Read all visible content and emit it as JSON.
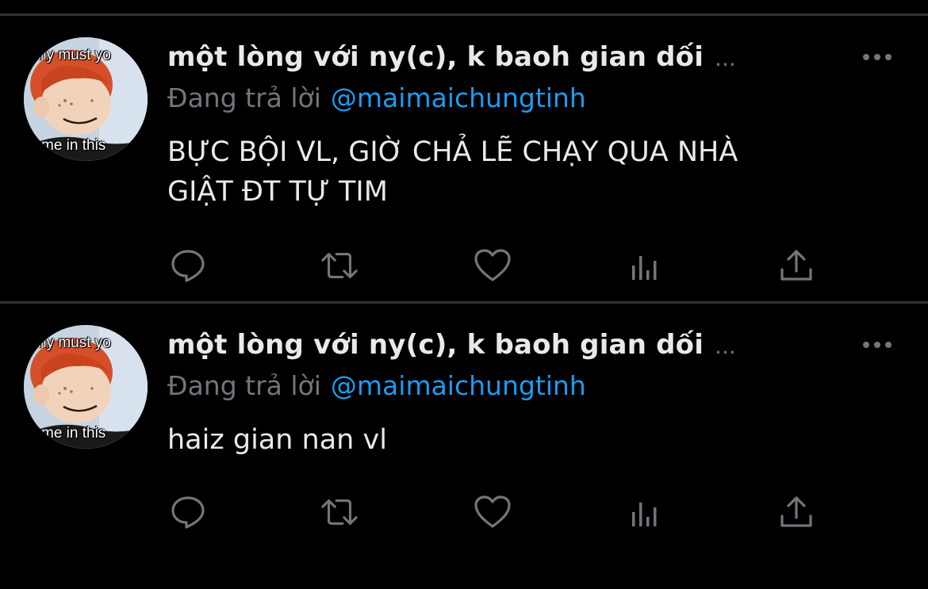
{
  "colors": {
    "background": "#000000",
    "text_primary": "#e7e9ea",
    "text_secondary": "#71767b",
    "accent": "#1d9bf0",
    "divider": "#2f3336"
  },
  "tweets": [
    {
      "avatar": {
        "caption_top": "hy must yo",
        "caption_bottom": "me in this"
      },
      "display_name": "một lòng với ny(c), k baoh gian dối",
      "name_ellipsis": "...",
      "reply_prefix": "Đang trả lời",
      "reply_to": "@maimaichungtinh",
      "text": "BỰC BỘI VL, GIỜ CHẢ LẼ CHẠY QUA NHÀ\nGIẬT ĐT TỰ TIM",
      "actions": [
        "reply-icon",
        "retweet-icon",
        "like-icon",
        "analytics-icon",
        "share-icon"
      ]
    },
    {
      "avatar": {
        "caption_top": "hy must yo",
        "caption_bottom": "me in this"
      },
      "display_name": "một lòng với ny(c), k baoh gian dối",
      "name_ellipsis": "...",
      "reply_prefix": "Đang trả lời",
      "reply_to": "@maimaichungtinh",
      "text": "haiz gian nan vl",
      "actions": [
        "reply-icon",
        "retweet-icon",
        "like-icon",
        "analytics-icon",
        "share-icon"
      ]
    }
  ]
}
